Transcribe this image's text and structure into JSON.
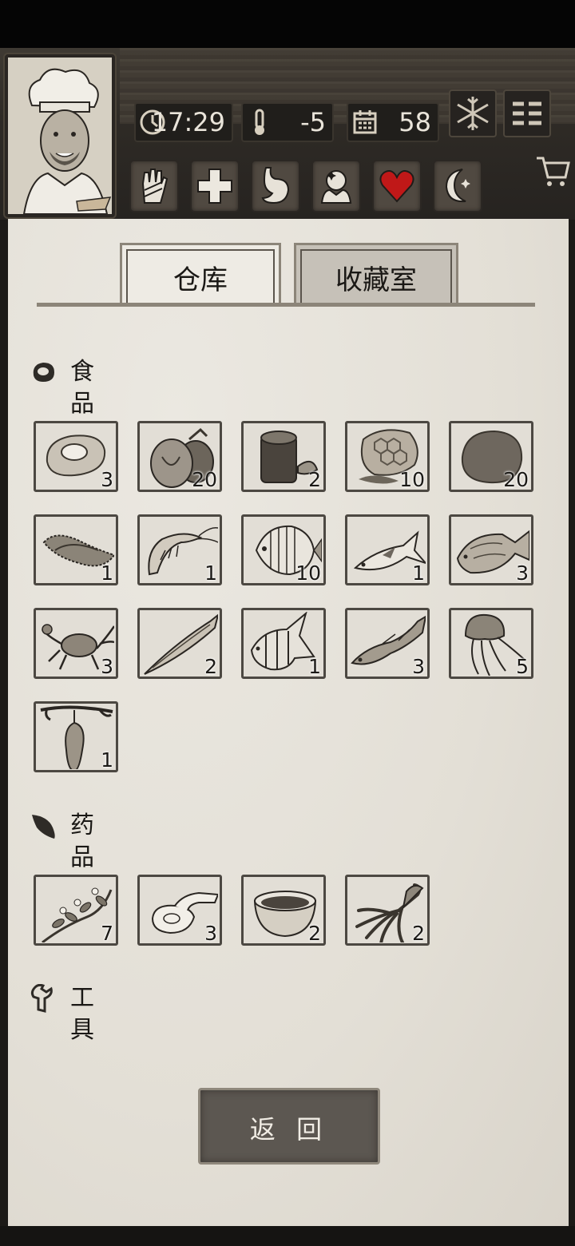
{
  "hud": {
    "time": "17:29",
    "temperature": "-5",
    "day": "58"
  },
  "tabs": [
    {
      "label": "仓库",
      "selected": true
    },
    {
      "label": "收藏室",
      "selected": false
    }
  ],
  "sections": {
    "food": {
      "title": "食品",
      "items": [
        {
          "icon": "meat-icon",
          "count": "3"
        },
        {
          "icon": "coconut-icon",
          "count": "20"
        },
        {
          "icon": "tea-can-icon",
          "count": "2"
        },
        {
          "icon": "honeycomb-icon",
          "count": "10"
        },
        {
          "icon": "potato-icon",
          "count": "20"
        },
        {
          "icon": "sea-cucumber-icon",
          "count": "1"
        },
        {
          "icon": "shrimp-icon",
          "count": "1"
        },
        {
          "icon": "butterflyfish-icon",
          "count": "10"
        },
        {
          "icon": "tuna-icon",
          "count": "1"
        },
        {
          "icon": "tilapia-icon",
          "count": "3"
        },
        {
          "icon": "crab-icon",
          "count": "3"
        },
        {
          "icon": "saury-icon",
          "count": "2"
        },
        {
          "icon": "angelfish-icon",
          "count": "1"
        },
        {
          "icon": "cod-icon",
          "count": "3"
        },
        {
          "icon": "jellyfish-icon",
          "count": "5"
        },
        {
          "icon": "hanging-fruit-icon",
          "count": "1"
        }
      ]
    },
    "medicine": {
      "title": "药品",
      "items": [
        {
          "icon": "herb-branch-icon",
          "count": "7"
        },
        {
          "icon": "bandage-icon",
          "count": "3"
        },
        {
          "icon": "soup-bowl-icon",
          "count": "2"
        },
        {
          "icon": "ginseng-icon",
          "count": "2"
        }
      ]
    },
    "tools": {
      "title": "工具",
      "items": []
    }
  },
  "back_button": "返 回",
  "colors": {
    "paper": "#e5e1d9",
    "wood": "#3a352e",
    "heart": "#c01818"
  }
}
